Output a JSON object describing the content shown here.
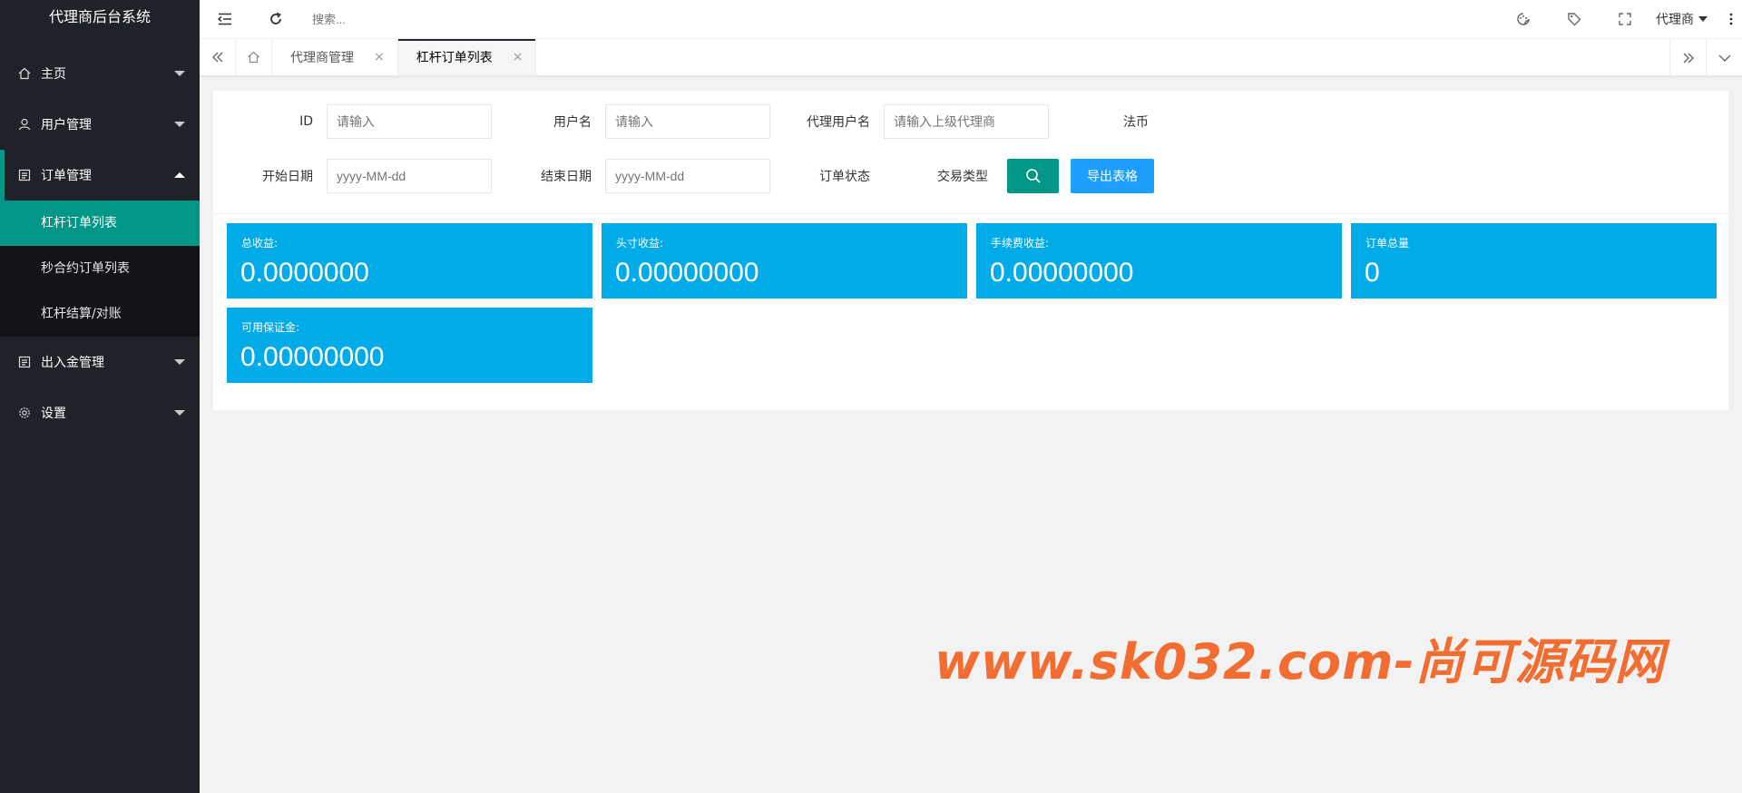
{
  "brand": "代理商后台系统",
  "nav": {
    "home": "主页",
    "users": "用户管理",
    "orders": "订单管理",
    "orders_sub": [
      "杠杆订单列表",
      "秒合约订单列表",
      "杠杆结算/对账"
    ],
    "funds": "出入金管理",
    "settings": "设置"
  },
  "header": {
    "search_placeholder": "搜索...",
    "user": "代理商"
  },
  "tabs": {
    "items": [
      "代理商管理",
      "杠杆订单列表"
    ],
    "close_glyph": "×",
    "active_index": 1
  },
  "filters": {
    "id_label": "ID",
    "id_placeholder": "请输入",
    "username_label": "用户名",
    "username_placeholder": "请输入",
    "agent_label": "代理用户名",
    "agent_placeholder": "请输入上级代理商",
    "currency_label": "法币",
    "start_label": "开始日期",
    "start_placeholder": "yyyy-MM-dd",
    "end_label": "结束日期",
    "end_placeholder": "yyyy-MM-dd",
    "status_label": "订单状态",
    "trade_type_label": "交易类型",
    "export_label": "导出表格"
  },
  "stats": [
    {
      "label": "总收益:",
      "value": "0.0000000"
    },
    {
      "label": "头寸收益:",
      "value": "0.00000000"
    },
    {
      "label": "手续费收益:",
      "value": "0.00000000"
    },
    {
      "label": "订单总量",
      "value": "0"
    },
    {
      "label": "可用保证金:",
      "value": "0.00000000"
    }
  ],
  "colors": {
    "sidebar": "#20222a",
    "accent": "#009688",
    "stat_card": "#00abe8",
    "export_button": "#1e9fff",
    "watermark": "#f26d32"
  },
  "watermark": "www.sk032.com-尚可源码网"
}
